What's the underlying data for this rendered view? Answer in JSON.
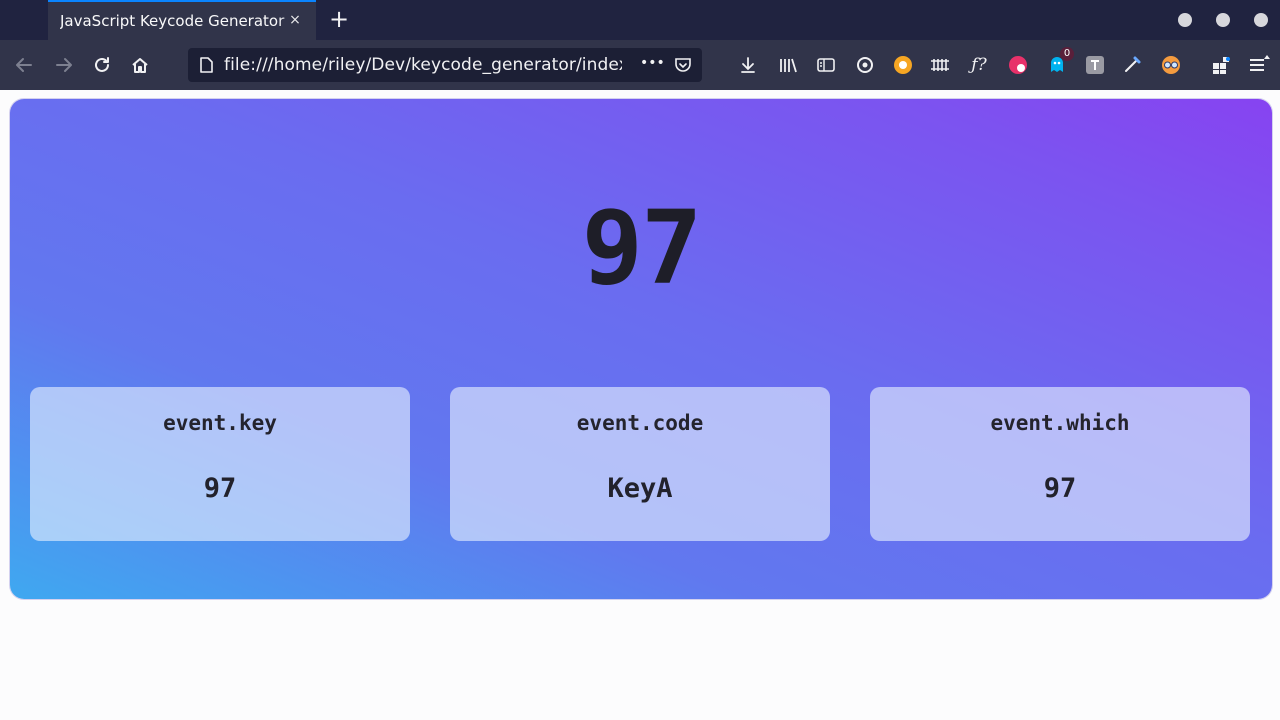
{
  "browser": {
    "tab_title": "JavaScript Keycode Generator",
    "tab_close_glyph": "×",
    "new_tab_glyph": "+",
    "url": "file:///home/riley/Dev/keycode_generator/index.html",
    "page_actions_glyph": "•••",
    "extension_badge_count": "0",
    "accent_color": "#0a84ff",
    "icons": [
      "back-arrow-icon",
      "forward-arrow-icon",
      "reload-icon",
      "home-icon",
      "page-icon",
      "pocket-icon",
      "download-icon",
      "library-icon",
      "sidebar-icon",
      "extension-icon",
      "script-icon",
      "function-icon",
      "menu-icon"
    ]
  },
  "page": {
    "keycode": "97",
    "cards": [
      {
        "title": "event.key",
        "value": "97"
      },
      {
        "title": "event.code",
        "value": "KeyA"
      },
      {
        "title": "event.which",
        "value": "97"
      }
    ],
    "gradient_colors": [
      "#3fa8f0",
      "#6178ef",
      "#8743f1"
    ]
  }
}
